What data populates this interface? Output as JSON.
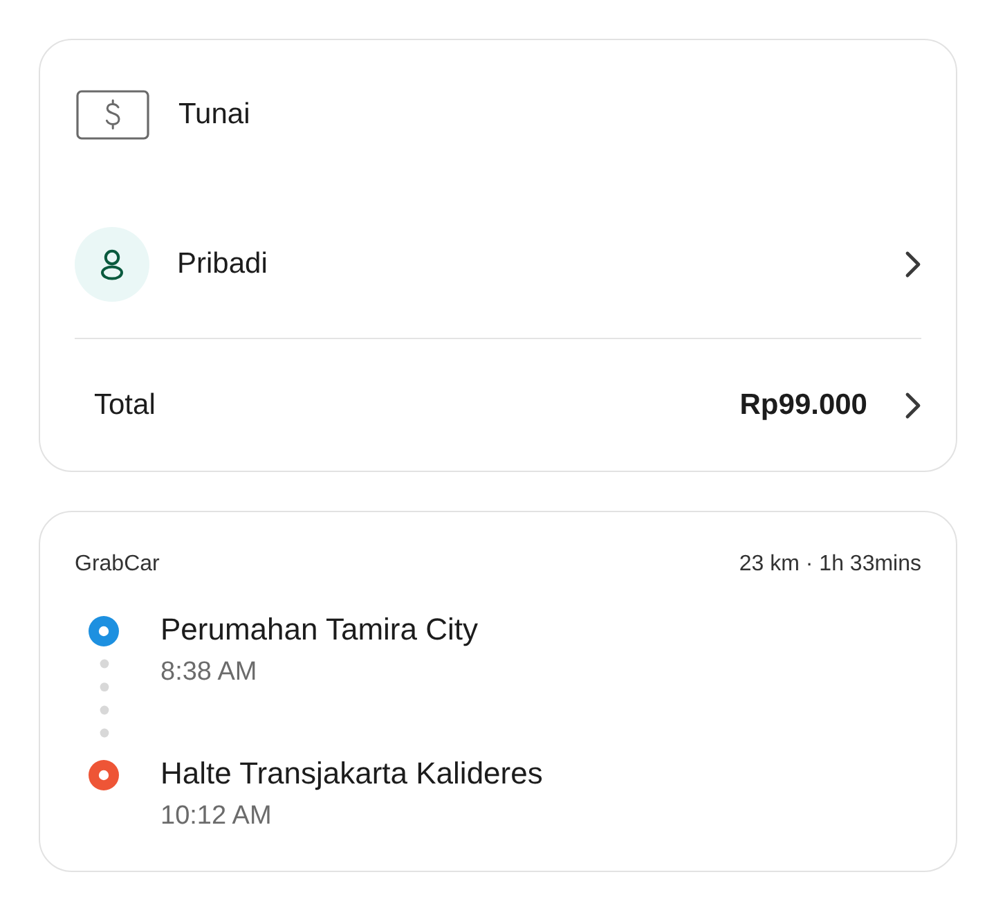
{
  "payment": {
    "method": {
      "label": "Tunai"
    },
    "profile": {
      "label": "Pribadi"
    },
    "total": {
      "label": "Total",
      "amount": "Rp99.000"
    }
  },
  "trip": {
    "service": "GrabCar",
    "summary": "23 km · 1h 33mins",
    "stops": [
      {
        "name": "Perumahan Tamira City",
        "time": "8:38 AM",
        "color": "#1d90e0"
      },
      {
        "name": "Halte Transjakarta Kalideres",
        "time": "10:12 AM",
        "color": "#ee5536"
      }
    ]
  }
}
